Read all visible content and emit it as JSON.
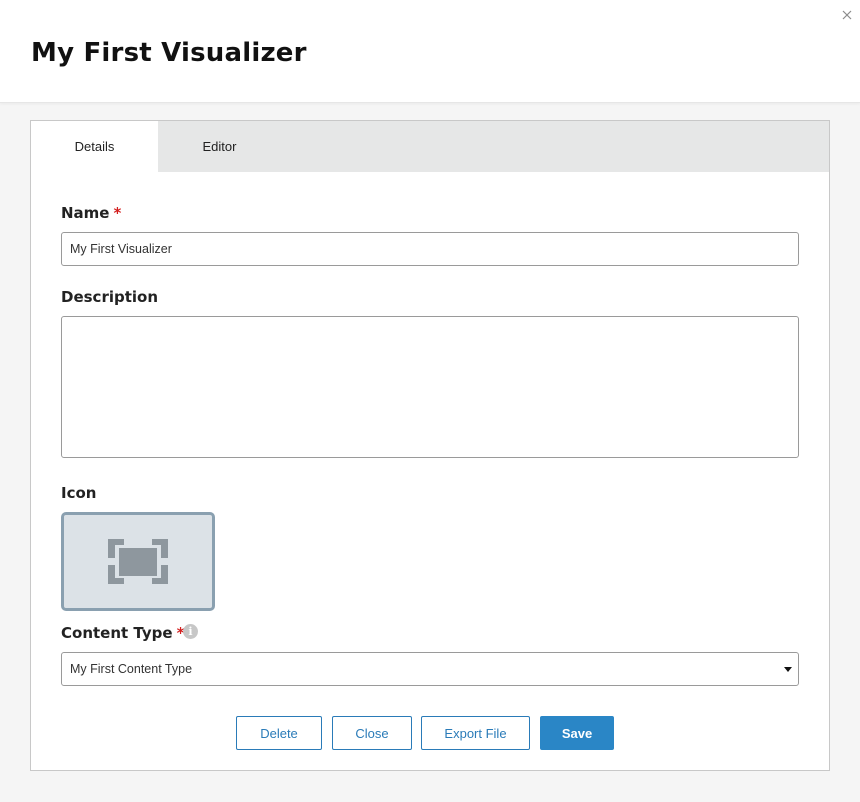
{
  "header": {
    "title": "My First Visualizer"
  },
  "tabs": [
    {
      "label": "Details",
      "active": true
    },
    {
      "label": "Editor",
      "active": false
    }
  ],
  "form": {
    "name_label": "Name",
    "name_value": "My First Visualizer",
    "required_marker": "*",
    "description_label": "Description",
    "description_value": "",
    "icon_label": "Icon",
    "icon_name": "frame-icon",
    "content_type_label": "Content Type",
    "content_type_info_glyph": "i",
    "content_type_value": "My First Content Type"
  },
  "buttons": {
    "delete": "Delete",
    "close": "Close",
    "export": "Export File",
    "save": "Save"
  },
  "colors": {
    "accent": "#2a86c6",
    "required": "#d31f1f",
    "icon_tile": "#dce2e7",
    "icon_tile_border": "#8aa0b0",
    "tab_bar": "#e6e7e7"
  }
}
